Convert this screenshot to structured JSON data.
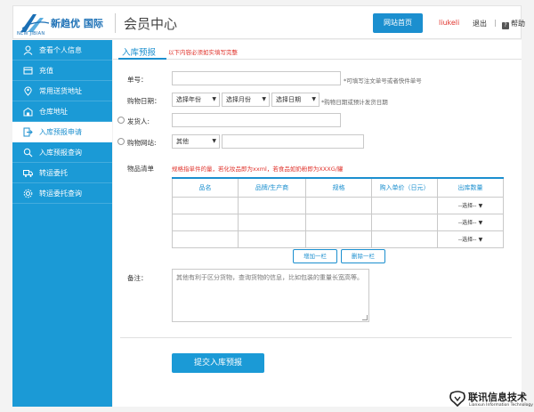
{
  "header": {
    "brand": "新趋优 国际",
    "brand_sub": "NEW JIBIAN",
    "title": "会员中心",
    "home_label": "网站首页",
    "username": "liukeli",
    "logout_label": "退出",
    "separator": "|",
    "help_label": "帮助",
    "help_glyph": "?"
  },
  "sidebar": {
    "items": [
      {
        "label": "查看个人信息",
        "icon": "user-icon"
      },
      {
        "label": "充值",
        "icon": "wallet-icon"
      },
      {
        "label": "常用送货地址",
        "icon": "location-icon"
      },
      {
        "label": "仓库地址",
        "icon": "warehouse-icon"
      },
      {
        "label": "入库预报申请",
        "icon": "import-icon"
      },
      {
        "label": "入库预报查询",
        "icon": "search-icon"
      },
      {
        "label": "转运委托",
        "icon": "truck-icon"
      },
      {
        "label": "转运委托查询",
        "icon": "gear-icon"
      }
    ]
  },
  "main": {
    "title": "入库预报",
    "notice": "以下内容必须如实填写完整",
    "order_no": {
      "label": "单号：",
      "value": "",
      "hint": "*可填写注文单号或者快件单号"
    },
    "buy_date": {
      "label": "购物日期：",
      "year": "选择年份",
      "month": "选择月份",
      "day": "选择日期",
      "hint": "*购物日期或预计发货日期"
    },
    "shipper": {
      "label": "发货人:",
      "value": ""
    },
    "site": {
      "label": "购物网站:",
      "select": "其他",
      "value": ""
    },
    "goods": {
      "label": "物品清单",
      "note": "规格指单件的量，若化妆品即为xxml，若食品如奶粉即为XXXG/罐",
      "columns": [
        "品名",
        "品牌/生产商",
        "规格",
        "购入单价（日元）",
        "出库数量"
      ],
      "rows": [
        {
          "name": "",
          "brand": "",
          "spec": "",
          "price": "",
          "qty": "--选择--"
        },
        {
          "name": "",
          "brand": "",
          "spec": "",
          "price": "",
          "qty": "--选择--"
        },
        {
          "name": "",
          "brand": "",
          "spec": "",
          "price": "",
          "qty": "--选择--"
        }
      ],
      "add_label": "增加一栏",
      "remove_label": "删除一栏"
    },
    "remark": {
      "label": "备注：",
      "placeholder": "其他有利于区分货物，查询货物的信息，比如包装的重量长宽高等。"
    },
    "submit_label": "提交入库预报"
  },
  "watermark": {
    "text": "联讯信息技术",
    "sub": "Lianxun Information Technology"
  },
  "colors": {
    "accent": "#1b9ad6",
    "danger": "#e0342d"
  }
}
